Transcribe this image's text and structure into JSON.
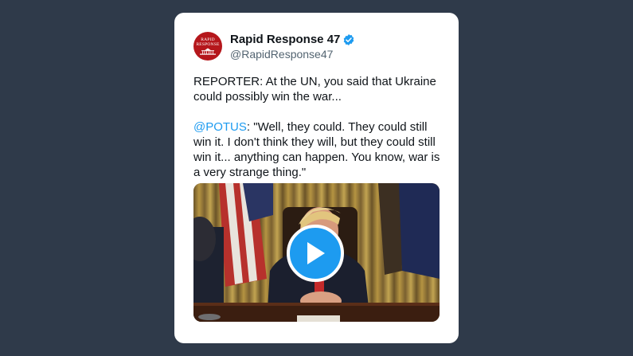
{
  "tweet": {
    "avatar": {
      "line1": "RAPID",
      "line2": "RESPONSE"
    },
    "display_name": "Rapid Response 47",
    "handle": "@RapidResponse47",
    "verified": true,
    "paragraph1": "REPORTER: At the UN, you said that Ukraine could possibly win the war...",
    "mention": "@POTUS",
    "paragraph2_rest": ": \"Well, they could. They could still win it. I don't think they will, but they could still win it... anything can happen. You know, war is a very strange thing.\"",
    "media": {
      "type": "video",
      "play_icon": "play-icon"
    }
  },
  "colors": {
    "background": "#2f3a4a",
    "card": "#ffffff",
    "accent": "#1d9bf0",
    "avatar": "#b5171c"
  }
}
